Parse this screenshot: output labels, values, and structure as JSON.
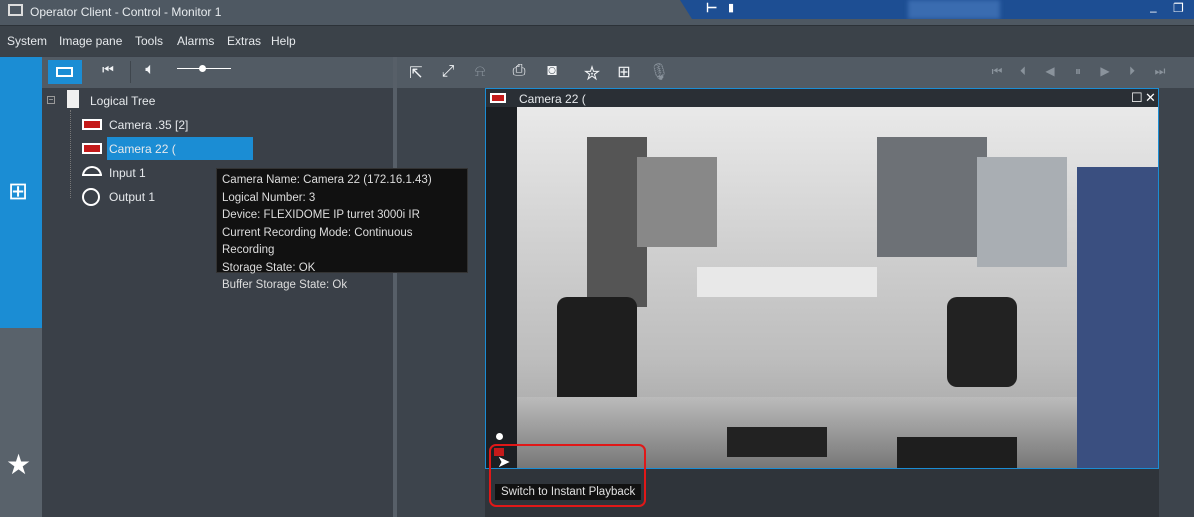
{
  "window": {
    "title": "Operator Client - Control - Monitor 1"
  },
  "menu": [
    "System",
    "Image pane",
    "Tools",
    "Alarms",
    "Extras",
    "Help"
  ],
  "tree": {
    "root": "Logical Tree",
    "items": [
      {
        "label": "Camera  .35 [2]",
        "icon": "camera-icon"
      },
      {
        "label": "Camera 22 (",
        "icon": "camera-icon",
        "selected": true
      },
      {
        "label": "Input 1",
        "icon": "input-icon"
      },
      {
        "label": "Output 1",
        "icon": "output-icon"
      }
    ]
  },
  "tooltip": {
    "lines": [
      "Camera Name: Camera 22 (172.16.1.43)",
      "Logical Number: 3",
      "Device: FLEXIDOME IP turret 3000i IR",
      "Current Recording Mode: Continuous Recording",
      "Storage State: OK",
      "Buffer Storage State: Ok"
    ]
  },
  "pane": {
    "title": "Camera 22 (",
    "hint": "Switch to Instant Playback"
  },
  "volume": 0.4,
  "colors": {
    "accent": "#1b8dd4",
    "highlight": "#e01818",
    "status_band": "#1d4e93"
  }
}
